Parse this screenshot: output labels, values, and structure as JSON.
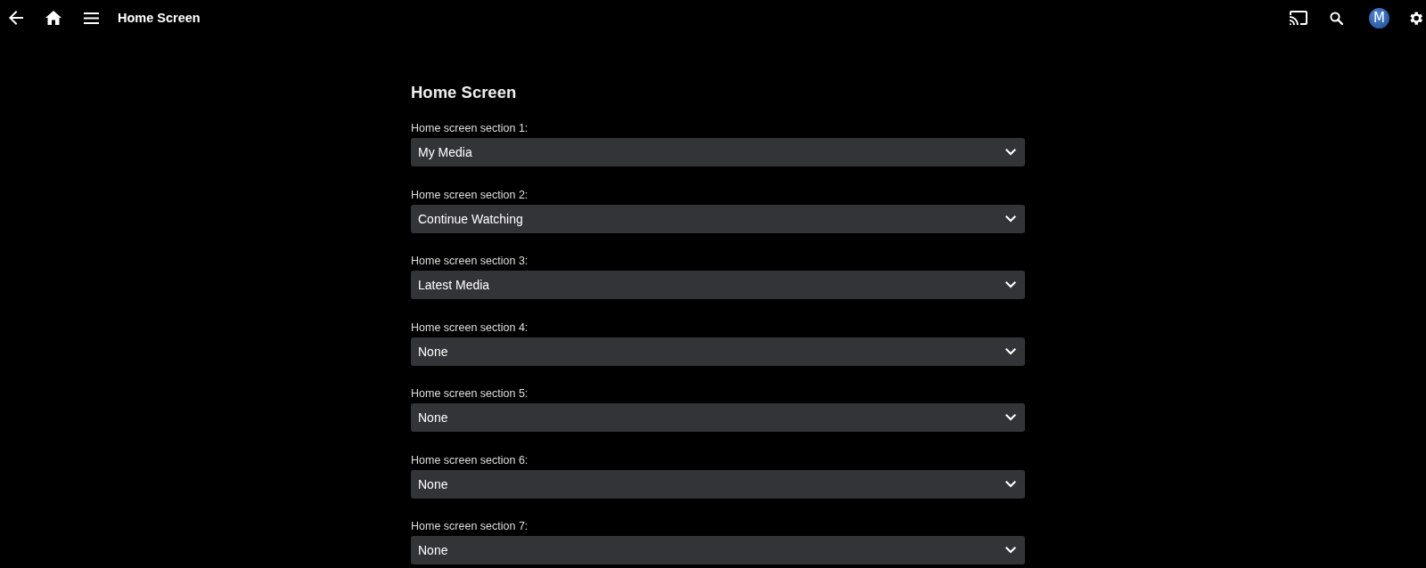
{
  "header": {
    "title": "Home Screen",
    "avatar": {
      "initial": "M"
    }
  },
  "page": {
    "heading": "Home Screen",
    "sections": [
      {
        "label": "Home screen section 1:",
        "value": "My Media"
      },
      {
        "label": "Home screen section 2:",
        "value": "Continue Watching"
      },
      {
        "label": "Home screen section 3:",
        "value": "Latest Media"
      },
      {
        "label": "Home screen section 4:",
        "value": "None"
      },
      {
        "label": "Home screen section 5:",
        "value": "None"
      },
      {
        "label": "Home screen section 6:",
        "value": "None"
      },
      {
        "label": "Home screen section 7:",
        "value": "None"
      }
    ]
  }
}
